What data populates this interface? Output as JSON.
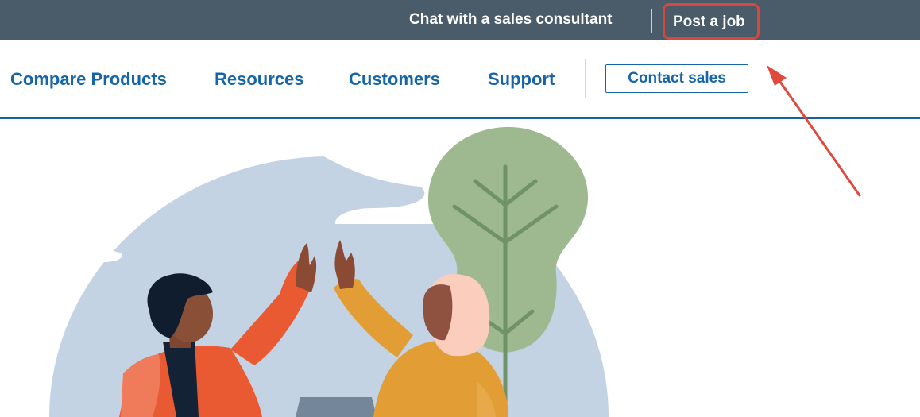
{
  "topbar": {
    "chat_label": "Chat with a sales consultant",
    "post_job_label": "Post a job"
  },
  "nav": {
    "items": [
      {
        "label": "Compare Products"
      },
      {
        "label": "Resources"
      },
      {
        "label": "Customers"
      },
      {
        "label": "Support"
      }
    ],
    "contact_label": "Contact sales"
  },
  "colors": {
    "topbar_bg": "#4a5b69",
    "nav_text": "#1565a8",
    "highlight": "#d9463b",
    "semicircle": "#c4d3e3",
    "tree": "#9eb98f"
  },
  "icons": {
    "annotation": "red-arrow-icon",
    "illustration": "high-five-people-illustration"
  }
}
